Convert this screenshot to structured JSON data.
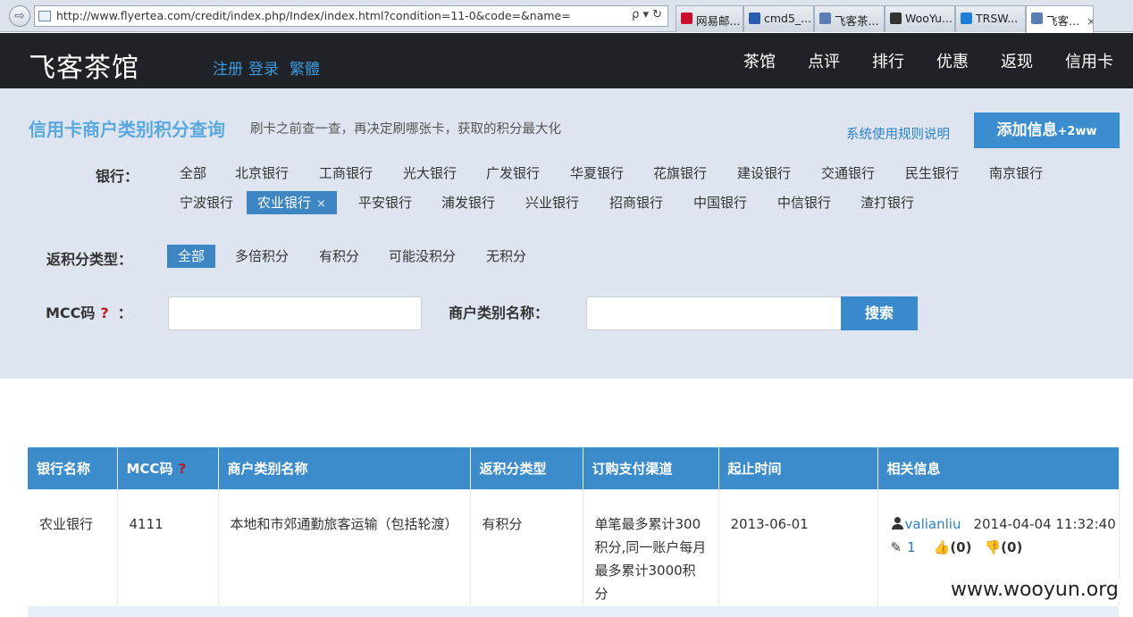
{
  "browser": {
    "url": "http://www.flyertea.com/credit/index.php/Index/index.html?condition=11-0&code=&name=",
    "address_controls": "ρ ▾ ↻",
    "tabs": [
      {
        "label": "网易邮...",
        "icon_color": "#c8102e"
      },
      {
        "label": "cmd5_...",
        "icon_color": "#2a5db0"
      },
      {
        "label": "飞客茶...",
        "icon_color": "#5a7fb5"
      },
      {
        "label": "WooYu...",
        "icon_color": "#333333"
      },
      {
        "label": "TRSW...",
        "icon_color": "#1e7fd6"
      },
      {
        "label": "飞客...",
        "icon_color": "#5a7fb5",
        "active": true
      }
    ],
    "close_glyph": "×"
  },
  "header": {
    "logo": "飞客茶馆",
    "auth": {
      "register": "注册",
      "login": "登录",
      "traditional": "繁體"
    },
    "nav": [
      "茶馆",
      "点评",
      "排行",
      "优惠",
      "返现",
      "信用卡"
    ]
  },
  "panel": {
    "title": "信用卡商户类别积分查询",
    "subtitle": "刷卡之前查一查，再决定刷哪张卡，获取的积分最大化",
    "rules_link": "系统使用规则说明",
    "add_button": {
      "label": "添加信息",
      "suffix": "+2ww"
    },
    "bank_label": "银行：",
    "banks_row1": [
      "全部",
      "北京银行",
      "工商银行",
      "光大银行",
      "广发银行",
      "华夏银行",
      "花旗银行",
      "建设银行",
      "交通银行",
      "民生银行",
      "南京银行"
    ],
    "banks_row2": [
      "宁波银行",
      "农业银行",
      "平安银行",
      "浦发银行",
      "兴业银行",
      "招商银行",
      "中国银行",
      "中信银行",
      "渣打银行"
    ],
    "selected_bank": "农业银行",
    "remove_glyph": "×",
    "type_label": "返积分类型：",
    "types": [
      "全部",
      "多倍积分",
      "有积分",
      "可能没积分",
      "无积分"
    ],
    "selected_type": "全部",
    "mcc_label": "MCC码",
    "mcc_help": "?",
    "mcc_colon": "：",
    "mcc_value": "",
    "merchant_label": "商户类别名称：",
    "merchant_value": "",
    "search_button": "搜索"
  },
  "table": {
    "headers": [
      "银行名称",
      "MCC码",
      "商户类别名称",
      "返积分类型",
      "订购支付渠道",
      "起止时间",
      "相关信息"
    ],
    "mcc_help": "?",
    "rows": [
      {
        "bank": "农业银行",
        "mcc": "4111",
        "merchant": "本地和市郊通勤旅客运输（包括轮渡）",
        "type": "有积分",
        "channel": "单笔最多累计300积分,同一账户每月最多累计3000积分",
        "date": "2013-06-01",
        "user": "valianliu",
        "time": "2014-04-04 11:32:40",
        "edits": "1",
        "up": "(0)",
        "down": "(0)"
      }
    ]
  },
  "watermark": "www.wooyun.org"
}
